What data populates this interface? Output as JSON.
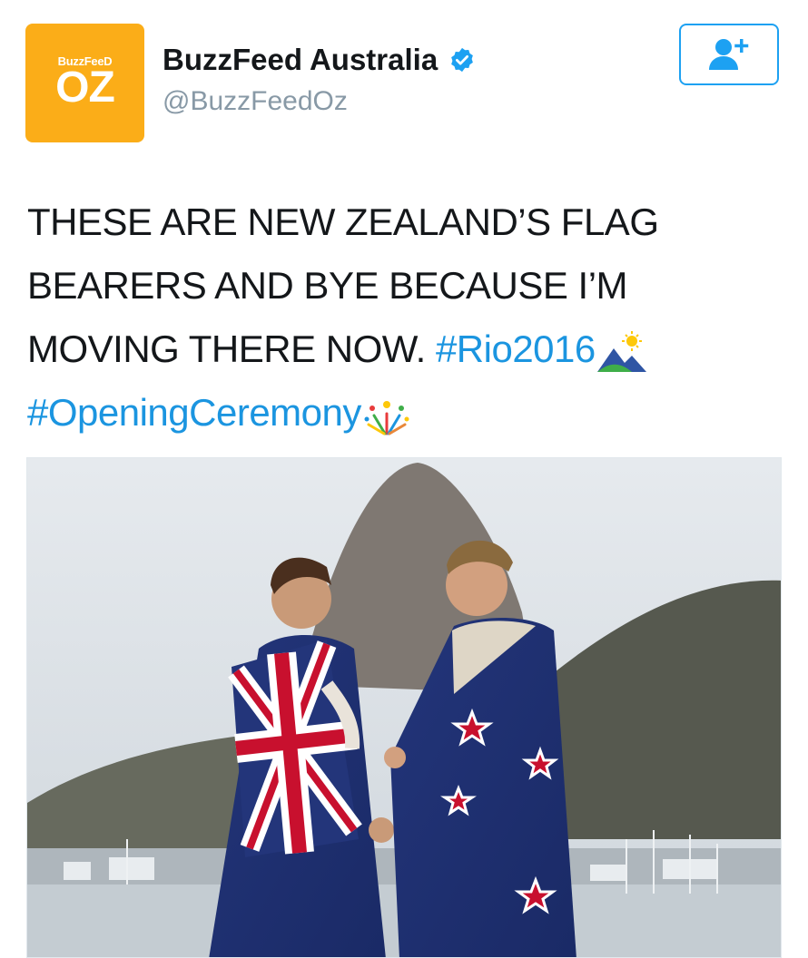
{
  "account": {
    "avatar_small_text": "BuzzFeeD",
    "avatar_big_text": "OZ",
    "display_name": "BuzzFeed Australia",
    "handle": "@BuzzFeedOz",
    "verified_icon": "verified-badge-icon",
    "follow_icon": "add-user-icon"
  },
  "tweet": {
    "line1": "THESE ARE NEW ZEALAND’S FLAG",
    "line2": "BEARERS AND BYE BECAUSE I’M",
    "line3": "MOVING THERE NOW.",
    "hashtag1": "#Rio2016",
    "hashtag2": "#OpeningCeremony",
    "emoji1": "mountain-sun-emoji",
    "emoji2": "fireworks-emoji"
  },
  "media": {
    "description_icon": "photo-flag-bearers"
  },
  "colors": {
    "avatar_bg": "#fbad18",
    "link": "#1b95e0",
    "follow_border": "#1da1f2",
    "handle": "#8899a6",
    "text": "#14171a"
  }
}
